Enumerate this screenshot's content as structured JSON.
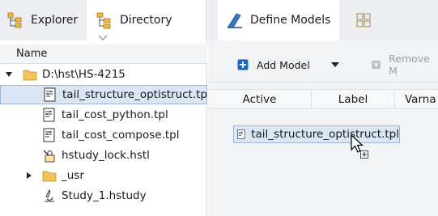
{
  "left_tabs": [
    {
      "label": "Explorer",
      "icon": "explorer-icon"
    },
    {
      "label": "Directory",
      "icon": "directory-icon"
    }
  ],
  "right_tabs": [
    {
      "label": "Define Models",
      "icon": "define-models-icon"
    },
    {
      "label": "",
      "icon": "grid-view-icon"
    }
  ],
  "tree": {
    "header": "Name",
    "items": [
      {
        "label": "D:\\hst\\HS-4215",
        "icon": "folder-icon",
        "expanded": true
      },
      {
        "label": "tail_structure_optistruct.tpl",
        "icon": "tpl-file-icon",
        "selected": true
      },
      {
        "label": "tail_cost_python.tpl",
        "icon": "tpl-file-icon"
      },
      {
        "label": "tail_cost_compose.tpl",
        "icon": "tpl-file-icon"
      },
      {
        "label": "hstudy_lock.hstl",
        "icon": "lock-file-icon"
      },
      {
        "label": "_usr",
        "icon": "folder-icon",
        "expanded": false
      },
      {
        "label": "Study_1.hstudy",
        "icon": "study-file-icon"
      }
    ]
  },
  "toolbar": {
    "add_model": "Add Model",
    "remove_model": "Remove M"
  },
  "columns": {
    "active": "Active",
    "label": "Label",
    "varname": "Varna"
  },
  "drag_item": {
    "label": "tail_structure_optistruct.tpl"
  },
  "colors": {
    "selection": "#dbe6f4",
    "selection_border": "#9cb7de",
    "accent_blue": "#1a66c4",
    "folder": "#e8b84a"
  }
}
